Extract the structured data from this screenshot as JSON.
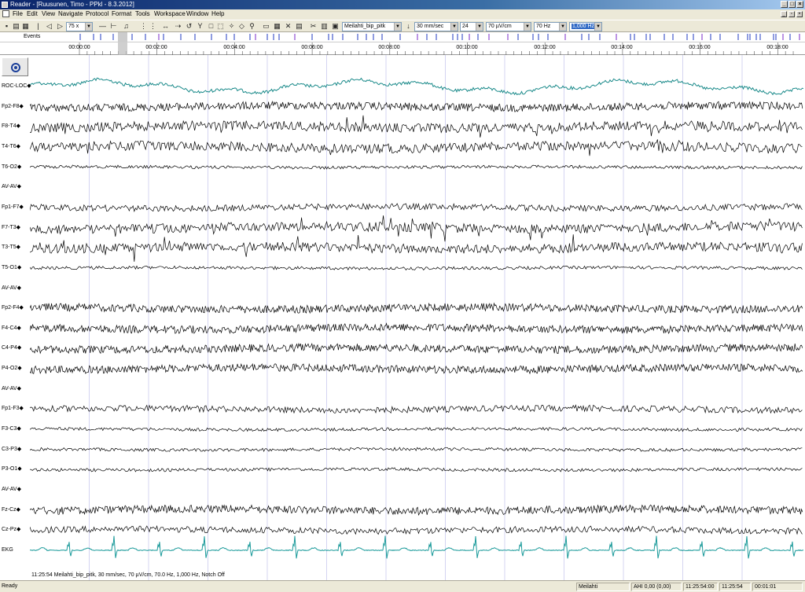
{
  "window": {
    "title": "Reader - [Ruusunen, Timo - PPkl - 8.3.2012]"
  },
  "menu": [
    "File",
    "Edit",
    "View",
    "Navigate",
    "Protocol",
    "Format",
    "Tools",
    "Workspace",
    "Window",
    "Help"
  ],
  "toolbar": {
    "zoom": "75 x",
    "montage": "Meilahti_bip_pitk",
    "speed": "30 mm/sec",
    "channels": "24",
    "sensitivity": "70 µV/cm",
    "low_pass": "70 Hz",
    "high_pass": "1,000 Hz"
  },
  "events": {
    "label": "Events"
  },
  "timeline": [
    "00:00:00",
    "00:02:00",
    "00:04:00",
    "00:06:00",
    "00:08:00",
    "00:10:00",
    "00:12:00",
    "00:14:00",
    "00:16:00",
    "00:18:00"
  ],
  "channels": [
    {
      "name": "ROC-LOC",
      "kind": "eog"
    },
    {
      "name": "Fp2-F8",
      "kind": "dense"
    },
    {
      "name": "F8-T4",
      "kind": "spiky"
    },
    {
      "name": "T4-T6",
      "kind": "spiky"
    },
    {
      "name": "T6-O2",
      "kind": "quiet"
    },
    {
      "name": "AV-AV",
      "kind": "blank"
    },
    {
      "name": "Fp1-F7",
      "kind": "medium"
    },
    {
      "name": "F7-T3",
      "kind": "spiky"
    },
    {
      "name": "T3-T5",
      "kind": "spiky"
    },
    {
      "name": "T5-O1",
      "kind": "quiet"
    },
    {
      "name": "AV-AV",
      "kind": "blank"
    },
    {
      "name": "Fp2-F4",
      "kind": "dense"
    },
    {
      "name": "F4-C4",
      "kind": "dense"
    },
    {
      "name": "C4-P4",
      "kind": "dense"
    },
    {
      "name": "P4-O2",
      "kind": "dense"
    },
    {
      "name": "AV-AV",
      "kind": "blank"
    },
    {
      "name": "Fp1-F3",
      "kind": "medium"
    },
    {
      "name": "F3-C3",
      "kind": "quiet"
    },
    {
      "name": "C3-P3",
      "kind": "quiet"
    },
    {
      "name": "P3-O1",
      "kind": "quiet"
    },
    {
      "name": "AV-AV",
      "kind": "blank"
    },
    {
      "name": "Fz-Cz",
      "kind": "dense"
    },
    {
      "name": "Cz-Pz",
      "kind": "medium"
    },
    {
      "name": "EKG",
      "kind": "ekg"
    }
  ],
  "info_text": "11:25:54 Meilahti_bip_pitk, 30 mm/sec, 70 µV/cm, 70.0 Hz, 1,000 Hz, Notch Off",
  "status": {
    "left": "Ready",
    "site": "Meilahti",
    "ahi": "AHI 0,00 (0,00)",
    "time_range": "11:25:54:00",
    "clock": "11:25:54",
    "elapsed": "00:01:01"
  },
  "colors": {
    "eog": "#1a8a8a",
    "ekg": "#1a9a9a",
    "trace": "#000000",
    "event_blue": "#1f3ac0",
    "event_purple": "#7a2ac8"
  }
}
